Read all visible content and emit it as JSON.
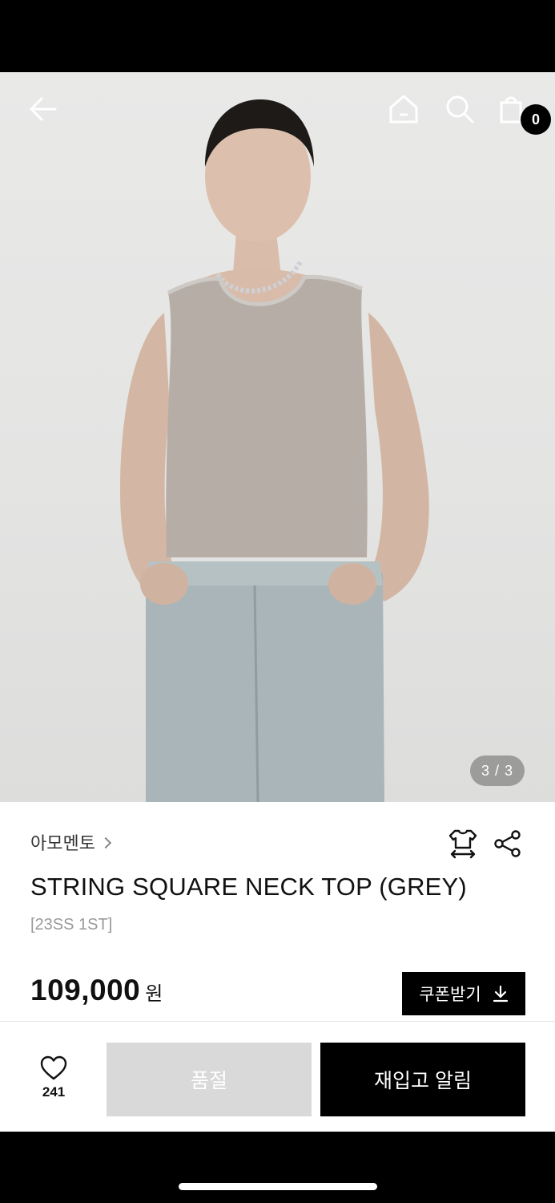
{
  "hero": {
    "page_indicator": "3 / 3"
  },
  "header": {
    "cart_count": "0",
    "icons": [
      "back-arrow-icon",
      "home-icon",
      "search-icon",
      "shopping-bag-icon"
    ]
  },
  "product": {
    "brand": "아모멘토",
    "title": "STRING SQUARE NECK TOP (GREY)",
    "subtitle": "[23SS 1ST]",
    "price": "109,000",
    "price_unit": "원",
    "coupon_label": "쿠폰받기"
  },
  "actions": {
    "like_count": "241",
    "soldout_label": "품절",
    "restock_label": "재입고 알림"
  },
  "colors": {
    "accent": "#000000",
    "disabled": "#d9d9d9",
    "muted_text": "#9a9a9a"
  }
}
